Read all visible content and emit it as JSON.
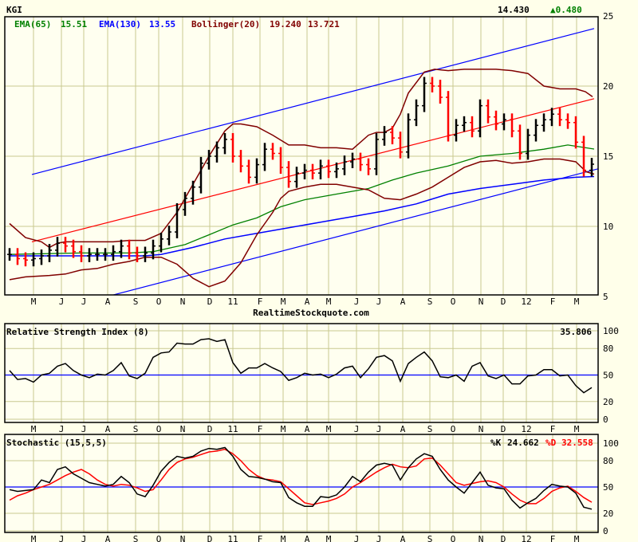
{
  "header": {
    "symbol": "KGI",
    "last": "14.430",
    "change": "▲0.480",
    "change_color": "#008000"
  },
  "watermark": "RealtimeStockquote.com",
  "colors": {
    "up": "#000000",
    "down": "#ff0000",
    "ema65": "#008000",
    "ema130": "#0000ff",
    "bollinger": "#800000",
    "grid": "#c8c890",
    "trend": "#ff0000",
    "channel": "#0000ff",
    "panel_bg": "#fffff0"
  },
  "chart_data": [
    {
      "type": "line",
      "title": "KGI price (weekly bars)",
      "legend": {
        "ema65": {
          "label": "EMA(65)",
          "value": "15.51"
        },
        "ema130": {
          "label": "EMA(130)",
          "value": "13.55"
        },
        "bollinger": {
          "label": "Bollinger(20)",
          "upper": "19.240",
          "lower": "13.721"
        }
      },
      "months": [
        "M",
        "J",
        "J",
        "A",
        "S",
        "O",
        "N",
        "D",
        "11",
        "F",
        "M",
        "A",
        "M",
        "J",
        "J",
        "A",
        "S",
        "O",
        "N",
        "D",
        "12",
        "F",
        "M"
      ],
      "y_ticks": [
        "25",
        "20",
        "15",
        "10",
        "5"
      ],
      "ylim": [
        5,
        25
      ],
      "closes": [
        8.0,
        7.7,
        7.6,
        7.7,
        7.9,
        8.3,
        8.8,
        8.6,
        8.2,
        7.9,
        8.0,
        8.0,
        8.0,
        8.2,
        8.6,
        8.1,
        7.9,
        8.1,
        8.6,
        9.1,
        9.6,
        11.2,
        12.0,
        12.8,
        14.5,
        15.0,
        15.6,
        16.2,
        15.0,
        14.3,
        13.5,
        14.4,
        15.5,
        15.2,
        14.2,
        13.2,
        13.8,
        14.0,
        13.8,
        14.3,
        13.9,
        14.1,
        14.6,
        14.8,
        14.4,
        14.1,
        16.2,
        16.7,
        16.3,
        15.3,
        17.6,
        18.6,
        20.2,
        20.0,
        19.2,
        16.5,
        17.2,
        17.4,
        16.8,
        18.6,
        17.8,
        17.3,
        17.6,
        16.8,
        15.2,
        16.5,
        17.2,
        17.6,
        18.0,
        17.6,
        17.4,
        16.0,
        14.0,
        14.43
      ],
      "bollinger_upper": [
        [
          0,
          10.2
        ],
        [
          2,
          9.2
        ],
        [
          4,
          8.9
        ],
        [
          5,
          8.5
        ],
        [
          6,
          8.8
        ],
        [
          7,
          8.9
        ],
        [
          9,
          8.9
        ],
        [
          13,
          8.9
        ],
        [
          15,
          9.0
        ],
        [
          17,
          9.0
        ],
        [
          19,
          9.5
        ],
        [
          21,
          11.0
        ],
        [
          23,
          13.0
        ],
        [
          25,
          15.0
        ],
        [
          27,
          16.8
        ],
        [
          28,
          17.3
        ],
        [
          29,
          17.3
        ],
        [
          31,
          17.1
        ],
        [
          33,
          16.5
        ],
        [
          35,
          15.8
        ],
        [
          37,
          15.8
        ],
        [
          39,
          15.6
        ],
        [
          41,
          15.6
        ],
        [
          43,
          15.5
        ],
        [
          45,
          16.5
        ],
        [
          46,
          16.7
        ],
        [
          47,
          16.7
        ],
        [
          48,
          17.0
        ],
        [
          49,
          18.0
        ],
        [
          50,
          19.5
        ],
        [
          52,
          21.0
        ],
        [
          53.3,
          21.2
        ],
        [
          55,
          21.1
        ],
        [
          57,
          21.2
        ],
        [
          61,
          21.2
        ],
        [
          63,
          21.1
        ],
        [
          65,
          20.9
        ],
        [
          67,
          20.0
        ],
        [
          69,
          19.8
        ],
        [
          71,
          19.8
        ],
        [
          72.2,
          19.6
        ],
        [
          73.1,
          19.24
        ]
      ],
      "bollinger_lower": [
        [
          0,
          6.2
        ],
        [
          2,
          6.4
        ],
        [
          5,
          6.5
        ],
        [
          7,
          6.6
        ],
        [
          9,
          6.9
        ],
        [
          11,
          7.0
        ],
        [
          13,
          7.3
        ],
        [
          15,
          7.5
        ],
        [
          17,
          7.8
        ],
        [
          19,
          7.8
        ],
        [
          21,
          7.3
        ],
        [
          23,
          6.3
        ],
        [
          25,
          5.7
        ],
        [
          27,
          6.1
        ],
        [
          29,
          7.4
        ],
        [
          31,
          9.4
        ],
        [
          33,
          11.0
        ],
        [
          34,
          12.0
        ],
        [
          35,
          12.5
        ],
        [
          37,
          12.8
        ],
        [
          39,
          13.0
        ],
        [
          41,
          13.0
        ],
        [
          43,
          12.8
        ],
        [
          45,
          12.6
        ],
        [
          47,
          12.0
        ],
        [
          49,
          11.9
        ],
        [
          51,
          12.3
        ],
        [
          53,
          12.8
        ],
        [
          55,
          13.5
        ],
        [
          57,
          14.2
        ],
        [
          59,
          14.6
        ],
        [
          61,
          14.7
        ],
        [
          63,
          14.5
        ],
        [
          65,
          14.6
        ],
        [
          67,
          14.8
        ],
        [
          69,
          14.8
        ],
        [
          71,
          14.6
        ],
        [
          72.3,
          13.9
        ],
        [
          73.3,
          13.72
        ]
      ],
      "ema65": [
        [
          0,
          8.0
        ],
        [
          9,
          8.1
        ],
        [
          15,
          8.1
        ],
        [
          18,
          8.2
        ],
        [
          22,
          8.7
        ],
        [
          25,
          9.4
        ],
        [
          28,
          10.1
        ],
        [
          31,
          10.6
        ],
        [
          34,
          11.4
        ],
        [
          37,
          11.9
        ],
        [
          41,
          12.3
        ],
        [
          45,
          12.7
        ],
        [
          48,
          13.3
        ],
        [
          51,
          13.8
        ],
        [
          55,
          14.3
        ],
        [
          59,
          15.0
        ],
        [
          63,
          15.2
        ],
        [
          67,
          15.5
        ],
        [
          70,
          15.8
        ],
        [
          73.3,
          15.51
        ]
      ],
      "ema130": [
        [
          0,
          7.9
        ],
        [
          17,
          7.9
        ],
        [
          19,
          8.0
        ],
        [
          23,
          8.5
        ],
        [
          27,
          9.1
        ],
        [
          31,
          9.5
        ],
        [
          35,
          9.9
        ],
        [
          39,
          10.3
        ],
        [
          43,
          10.7
        ],
        [
          47,
          11.1
        ],
        [
          51,
          11.6
        ],
        [
          55,
          12.3
        ],
        [
          59,
          12.7
        ],
        [
          63,
          13.0
        ],
        [
          67,
          13.3
        ],
        [
          71,
          13.5
        ],
        [
          73.3,
          13.55
        ]
      ],
      "trend_line": [
        [
          2.8,
          8.9
        ],
        [
          73.3,
          19.1
        ]
      ],
      "channel_upper": [
        [
          2.8,
          13.7
        ],
        [
          73.3,
          24.1
        ]
      ],
      "channel_lower": [
        [
          2.8,
          3.6
        ],
        [
          73.8,
          14.1
        ]
      ]
    },
    {
      "type": "line",
      "title": "Relative Strength Index (8)",
      "last_value": "35.806",
      "y_ticks": [
        "100",
        "80",
        "50",
        "20",
        "0"
      ],
      "ylim": [
        0,
        100
      ],
      "reference": 50,
      "values": [
        55,
        45,
        46,
        42,
        50,
        52,
        60,
        63,
        55,
        50,
        47,
        51,
        50,
        55,
        64,
        49,
        46,
        52,
        70,
        75,
        76,
        86,
        85,
        85,
        90,
        91,
        88,
        90,
        64,
        52,
        58,
        58,
        63,
        58,
        54,
        44,
        47,
        52,
        50,
        51,
        47,
        51,
        58,
        60,
        47,
        57,
        70,
        72,
        66,
        43,
        63,
        70,
        76,
        66,
        48,
        47,
        50,
        43,
        60,
        64,
        49,
        46,
        50,
        40,
        40,
        49,
        50,
        56,
        56,
        49,
        50,
        38,
        30,
        35.8
      ]
    },
    {
      "type": "line",
      "title": "Stochastic (15,5,5)",
      "k_label": "%K",
      "k_value": "24.662",
      "d_label": "%D",
      "d_value": "32.558",
      "y_ticks": [
        "100",
        "80",
        "50",
        "20",
        "0"
      ],
      "ylim": [
        0,
        100
      ],
      "reference": 50,
      "k": [
        47,
        45,
        46,
        47,
        58,
        55,
        70,
        73,
        65,
        60,
        55,
        53,
        51,
        53,
        62,
        55,
        42,
        39,
        52,
        68,
        78,
        85,
        83,
        85,
        91,
        94,
        93,
        95,
        85,
        70,
        62,
        61,
        59,
        56,
        55,
        38,
        32,
        28,
        28,
        39,
        38,
        41,
        50,
        62,
        56,
        67,
        75,
        77,
        75,
        58,
        72,
        82,
        88,
        85,
        70,
        58,
        50,
        43,
        55,
        67,
        52,
        49,
        48,
        35,
        26,
        32,
        37,
        46,
        53,
        51,
        50,
        43,
        27,
        24.7
      ],
      "d": [
        35,
        40,
        43,
        47,
        50,
        53,
        58,
        63,
        67,
        70,
        65,
        58,
        53,
        51,
        53,
        52,
        49,
        45,
        47,
        58,
        70,
        78,
        82,
        84,
        87,
        90,
        91,
        93,
        88,
        80,
        70,
        63,
        59,
        58,
        56,
        48,
        40,
        32,
        30,
        32,
        34,
        37,
        42,
        50,
        55,
        61,
        67,
        72,
        76,
        73,
        72,
        74,
        82,
        83,
        75,
        65,
        55,
        52,
        54,
        56,
        57,
        55,
        50,
        42,
        35,
        31,
        31,
        37,
        45,
        49,
        51,
        45,
        38,
        32.6
      ]
    }
  ]
}
